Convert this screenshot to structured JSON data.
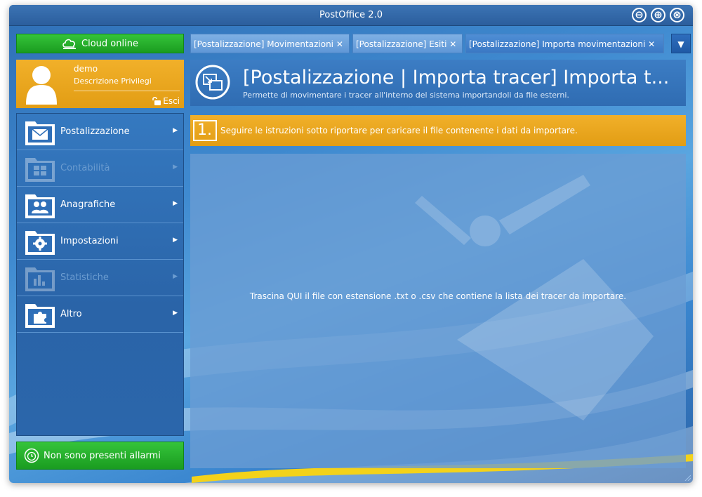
{
  "window": {
    "title": "PostOffice 2.0",
    "controls": [
      "⊖",
      "⊕",
      "⊗"
    ]
  },
  "sidebar": {
    "cloud_label": "Cloud online",
    "user": {
      "name": "demo",
      "privileges": "Descrizione Privilegi",
      "exit_label": "Esci"
    },
    "menu": [
      {
        "label": "Postalizzazione",
        "icon": "envelope-icon",
        "enabled": true
      },
      {
        "label": "Contabilità",
        "icon": "calculator-icon",
        "enabled": false
      },
      {
        "label": "Anagrafiche",
        "icon": "users-icon",
        "enabled": true
      },
      {
        "label": "Impostazioni",
        "icon": "gear-icon",
        "enabled": true
      },
      {
        "label": "Statistiche",
        "icon": "bar-chart-icon",
        "enabled": false
      },
      {
        "label": "Altro",
        "icon": "puzzle-icon",
        "enabled": true
      }
    ],
    "alarm_label": "Non sono presenti allarmi"
  },
  "tabs": [
    {
      "label": "[Postalizzazione] Movimentazioni",
      "active": false
    },
    {
      "label": "[Postalizzazione] Esiti",
      "active": false
    },
    {
      "label": "[Postalizzazione] Importa movimentazioni",
      "active": true
    }
  ],
  "tab_close": "✕",
  "header": {
    "title": "[Postalizzazione | Importa tracer] Importa t...",
    "subtitle": "Permette di movimentare i tracer all'interno del sistema importandoli da file esterni."
  },
  "step": {
    "number": "1.",
    "text": "Seguire le istruzioni sotto riportare per caricare il file contenente i dati da importare."
  },
  "drop_zone": {
    "text": "Trascina QUI il file con estensione .txt o .csv che contiene la lista dei tracer da importare."
  },
  "colors": {
    "green": "#1a9c20",
    "orange": "#e29d14",
    "blue": "#2f6cb2"
  }
}
